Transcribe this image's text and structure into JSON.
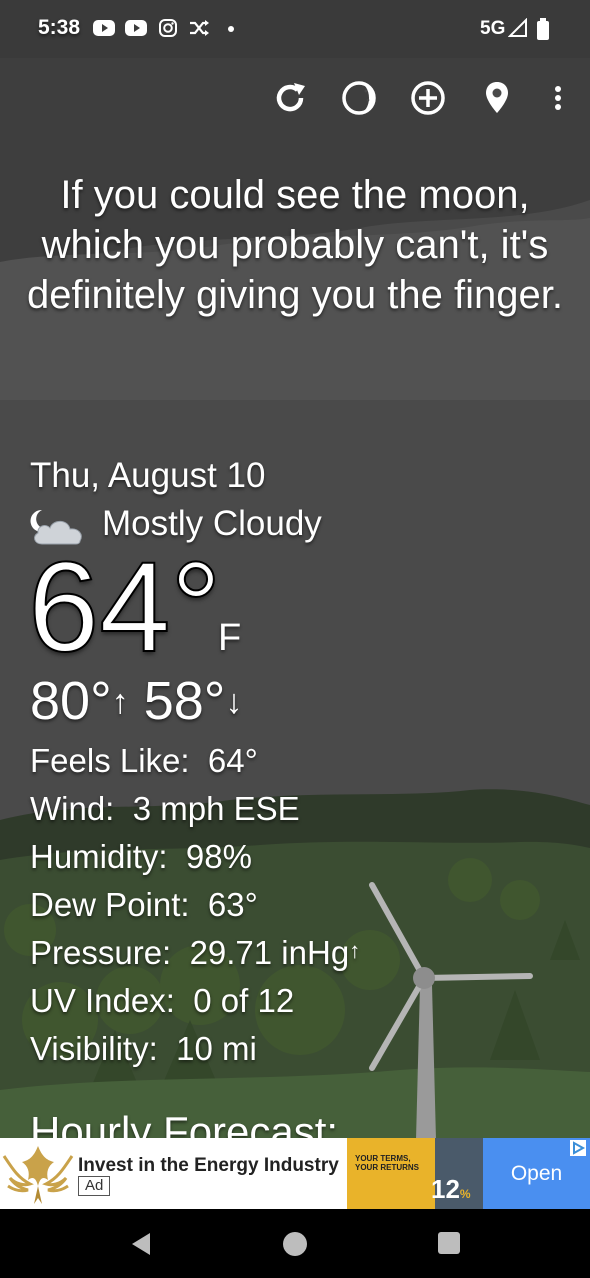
{
  "status_bar": {
    "time": "5:38",
    "network": "5G",
    "icons": [
      "youtube-icon",
      "youtube-icon",
      "instagram-icon",
      "shuffle-icon",
      "dot-icon",
      "signal-icon",
      "battery-icon"
    ]
  },
  "toolbar": {
    "buttons": [
      "refresh-icon",
      "moon-phase-icon",
      "add-location-icon",
      "location-pin-icon",
      "more-vert-icon"
    ]
  },
  "quote": "If you could see the moon, which you probably can't, it's definitely giving you the finger.",
  "weather": {
    "date": "Thu, August 10",
    "condition": "Mostly Cloudy",
    "condition_icon": "partly-cloudy-night-icon",
    "temperature": "64°",
    "unit": "F",
    "high": "80°",
    "low": "58°",
    "high_arrow": "↑",
    "low_arrow": "↓"
  },
  "details": {
    "feels_like_label": "Feels Like:",
    "feels_like": "64°",
    "wind_label": "Wind:",
    "wind": "3 mph ESE",
    "humidity_label": "Humidity:",
    "humidity": "98%",
    "dew_point_label": "Dew Point:",
    "dew_point": "63°",
    "pressure_label": "Pressure:",
    "pressure": "29.71 inHg",
    "pressure_arrow": "↑",
    "uv_label": "UV Index:",
    "uv": "0 of 12",
    "visibility_label": "Visibility:",
    "visibility": "10 mi"
  },
  "hourly_heading": "Hourly Forecast:",
  "ad": {
    "headline": "Invest in the Energy Industry",
    "badge": "Ad",
    "promo_line1": "YOUR TERMS,",
    "promo_line2": "YOUR RETURNS",
    "promo_rate": "12",
    "promo_pct": "%",
    "cta": "Open"
  },
  "nav": {
    "buttons": [
      "back-icon",
      "home-icon",
      "recents-icon"
    ]
  },
  "colors": {
    "sky": "#4d4d4d",
    "hills": "#3d5233",
    "ad_yellow": "#e9b32a",
    "ad_blue": "#4a8ff0"
  }
}
